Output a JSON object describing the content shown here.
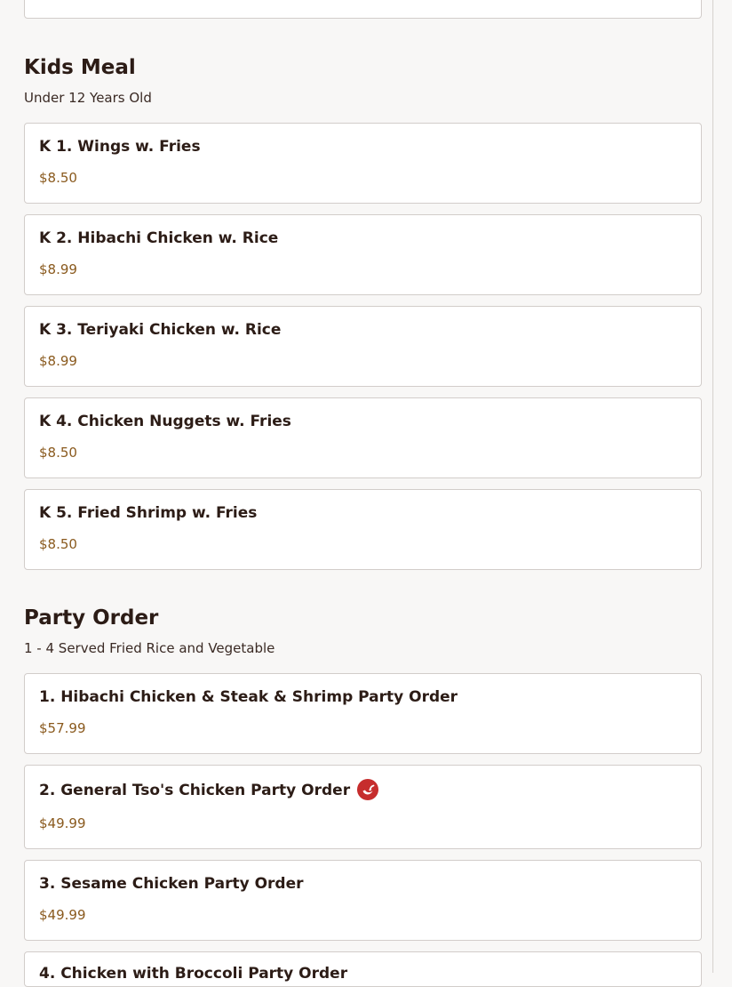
{
  "sections": [
    {
      "title": "Kids Meal",
      "subtitle": "Under 12 Years Old",
      "items": [
        {
          "name": "K 1. Wings w. Fries",
          "price": "$8.50"
        },
        {
          "name": "K 2. Hibachi Chicken w. Rice",
          "price": "$8.99"
        },
        {
          "name": "K 3. Teriyaki Chicken w. Rice",
          "price": "$8.99"
        },
        {
          "name": "K 4. Chicken Nuggets w. Fries",
          "price": "$8.50"
        },
        {
          "name": "K 5. Fried Shrimp w. Fries",
          "price": "$8.50"
        }
      ]
    },
    {
      "title": "Party Order",
      "subtitle": "1 - 4 Served Fried Rice and Vegetable",
      "items": [
        {
          "name": "1. Hibachi Chicken & Steak & Shrimp Party Order",
          "price": "$57.99"
        },
        {
          "name": "2. General Tso's Chicken Party Order",
          "price": "$49.99",
          "icon": "spicy-pepper-icon"
        },
        {
          "name": "3. Sesame Chicken Party Order",
          "price": "$49.99"
        },
        {
          "name": "4. Chicken with Broccoli Party Order",
          "price": ""
        }
      ]
    }
  ],
  "colors": {
    "page_background": "#f8f7f6",
    "card_background": "#ffffff",
    "card_border": "#d2cdca",
    "text": "#2c1c16",
    "price": "#8a5a1e",
    "spicy": "#c62d2d"
  }
}
